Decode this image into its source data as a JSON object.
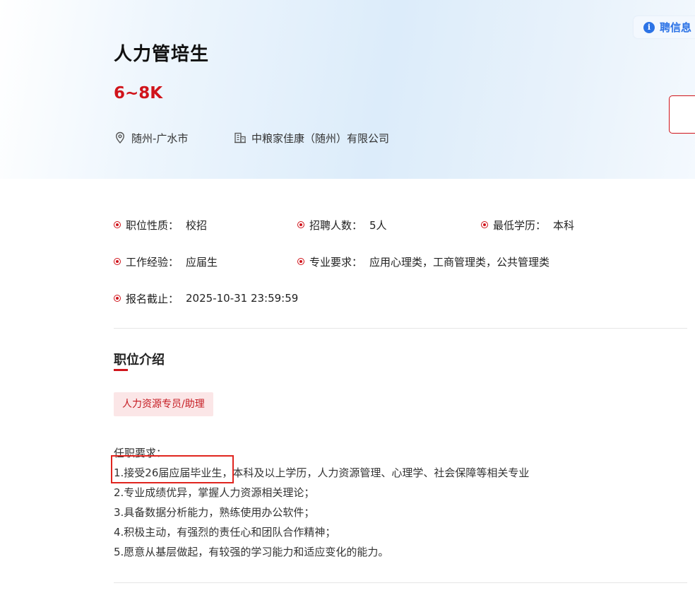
{
  "header": {
    "title": "人力管培生",
    "salary": "6~8K",
    "location": "随州-广水市",
    "company": "中粮家佳康（随州）有限公司",
    "info_badge_label": "聘信息"
  },
  "attributes": [
    {
      "label": "职位性质：",
      "value": "校招"
    },
    {
      "label": "招聘人数：",
      "value": "5人"
    },
    {
      "label": "最低学历：",
      "value": "本科"
    },
    {
      "label": "工作经验：",
      "value": "应届生"
    },
    {
      "label": "专业要求：",
      "value": "应用心理类，工商管理类，公共管理类"
    },
    {
      "label": "报名截止：",
      "value": "2025-10-31 23:59:59"
    }
  ],
  "description": {
    "section_title": "职位介绍",
    "tag": "人力资源专员/助理",
    "lines": [
      "任职要求：",
      "1.接受26届应届毕业生，本科及以上学历，人力资源管理、心理学、社会保障等相关专业",
      "2.专业成绩优异，掌握人力资源相关理论；",
      "3.具备数据分析能力，熟练使用办公软件；",
      "4.积极主动，有强烈的责任心和团队合作精神；",
      "5.愿意从基层做起，有较强的学习能力和适应变化的能力。"
    ]
  },
  "colors": {
    "accent": "#d0141b",
    "info_blue": "#2c73e6",
    "tag_bg": "#fbe6e7",
    "highlight": "#e0251f"
  }
}
